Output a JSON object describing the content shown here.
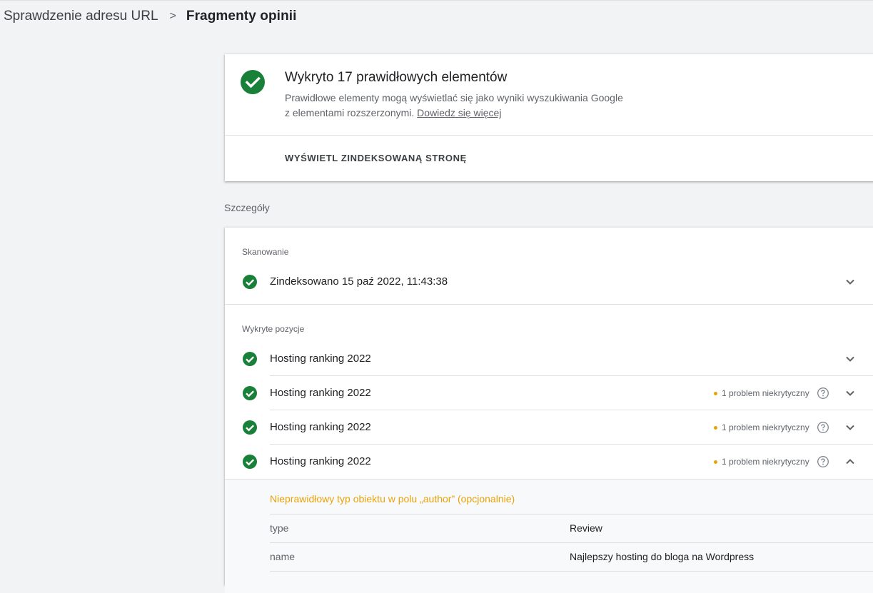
{
  "breadcrumb": {
    "parent": "Sprawdzenie adresu URL",
    "separator": ">",
    "current": "Fragmenty opinii"
  },
  "summary": {
    "title": "Wykryto 17 prawidłowych elementów",
    "description_line1": "Prawidłowe elementy mogą wyświetlać się jako wyniki wyszukiwania Google",
    "description_line2": "z elementami rozszerzonymi.",
    "learn_more": "Dowiedz się więcej",
    "view_button": "WYŚWIETL ZINDEKSOWANĄ STRONĘ"
  },
  "details": {
    "section_label": "Szczegóły",
    "crawl": {
      "label": "Skanowanie",
      "item": "Zindeksowano 15 paź 2022, 11:43:38"
    },
    "detected": {
      "label": "Wykryte pozycje",
      "items": [
        {
          "title": "Hosting ranking 2022",
          "issue": ""
        },
        {
          "title": "Hosting ranking 2022",
          "issue": "1 problem niekrytyczny"
        },
        {
          "title": "Hosting ranking 2022",
          "issue": "1 problem niekrytyczny"
        },
        {
          "title": "Hosting ranking 2022",
          "issue": "1 problem niekrytyczny"
        }
      ]
    },
    "expanded": {
      "warning": "Nieprawidłowy typ obiektu w polu „author” (opcjonalnie)",
      "properties": [
        {
          "key": "type",
          "value": "Review"
        },
        {
          "key": "name",
          "value": "Najlepszy hosting do bloga na Wordpress"
        }
      ]
    }
  },
  "colors": {
    "success": "#188038",
    "warning": "#e8a30c",
    "background": "#f1f3f4"
  },
  "icons": {
    "success": "check-circle-icon",
    "expand": "chevron-down-icon",
    "collapse": "chevron-up-icon",
    "help": "help-icon",
    "separator": "chevron-right-icon"
  }
}
